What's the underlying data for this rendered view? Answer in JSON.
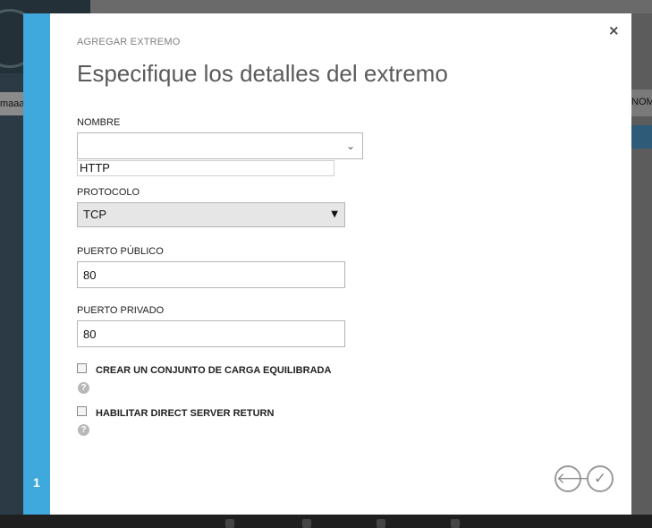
{
  "background": {
    "left_snippet": "maaaa",
    "right_snippet": "NOMB"
  },
  "dialog": {
    "subtitle": "AGREGAR EXTREMO",
    "title": "Especifique los detalles del extremo",
    "close_icon": "×",
    "step_number": "1",
    "fields": {
      "nombre": {
        "label": "NOMBRE",
        "value": "",
        "suggestion": "HTTP"
      },
      "protocolo": {
        "label": "PROTOCOLO",
        "value": "TCP"
      },
      "puerto_publico": {
        "label": "PUERTO PÚBLICO",
        "value": "80"
      },
      "puerto_privado": {
        "label": "PUERTO PRIVADO",
        "value": "80"
      }
    },
    "checkboxes": [
      {
        "label": "CREAR UN CONJUNTO DE CARGA EQUILIBRADA",
        "checked": false
      },
      {
        "label": "HABILITAR DIRECT SERVER RETURN",
        "checked": false
      }
    ],
    "help_icon": "?",
    "buttons": {
      "back_icon": "arrow-left-icon",
      "ok_icon": "checkmark-icon"
    }
  }
}
